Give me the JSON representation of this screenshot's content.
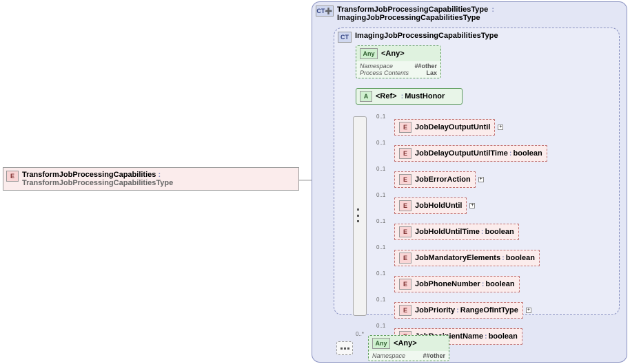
{
  "root": {
    "name": "TransformJobProcessingCapabilities",
    "type": "TransformJobProcessingCapabilitiesType"
  },
  "complexType": {
    "name": "TransformJobProcessingCapabilitiesType",
    "base": "ImagingJobProcessingCapabilitiesType"
  },
  "innerType": {
    "name": "ImagingJobProcessingCapabilitiesType"
  },
  "anyBox": {
    "label": "<Any>",
    "namespace_label": "Namespace",
    "namespace_value": "##other",
    "process_label": "Process Contents",
    "process_value": "Lax"
  },
  "refBox": {
    "label": "<Ref>",
    "name": "MustHonor"
  },
  "elements": [
    {
      "name": "JobDelayOutputUntil",
      "type": "",
      "occurs": "0..1",
      "expand": true,
      "dashed": true
    },
    {
      "name": "JobDelayOutputUntilTime",
      "type": "boolean",
      "occurs": "0..1",
      "expand": false,
      "dashed": true
    },
    {
      "name": "JobErrorAction",
      "type": "",
      "occurs": "0..1",
      "expand": true,
      "dashed": true
    },
    {
      "name": "JobHoldUntil",
      "type": "",
      "occurs": "0..1",
      "expand": true,
      "dashed": true
    },
    {
      "name": "JobHoldUntilTime",
      "type": "boolean",
      "occurs": "0..1",
      "expand": false,
      "dashed": true
    },
    {
      "name": "JobMandatoryElements",
      "type": "boolean",
      "occurs": "0..1",
      "expand": false,
      "dashed": true
    },
    {
      "name": "JobPhoneNumber",
      "type": "boolean",
      "occurs": "0..1",
      "expand": false,
      "dashed": true
    },
    {
      "name": "JobPriority",
      "type": "RangeOfIntType",
      "occurs": "0..1",
      "expand": true,
      "dashed": true
    },
    {
      "name": "JobRecipientName",
      "type": "boolean",
      "occurs": "0..1",
      "expand": false,
      "dashed": true
    }
  ],
  "bottomSeq": {
    "occurs": "0..*"
  },
  "bottomAny": {
    "label": "<Any>",
    "namespace_label": "Namespace",
    "namespace_value": "##other"
  }
}
